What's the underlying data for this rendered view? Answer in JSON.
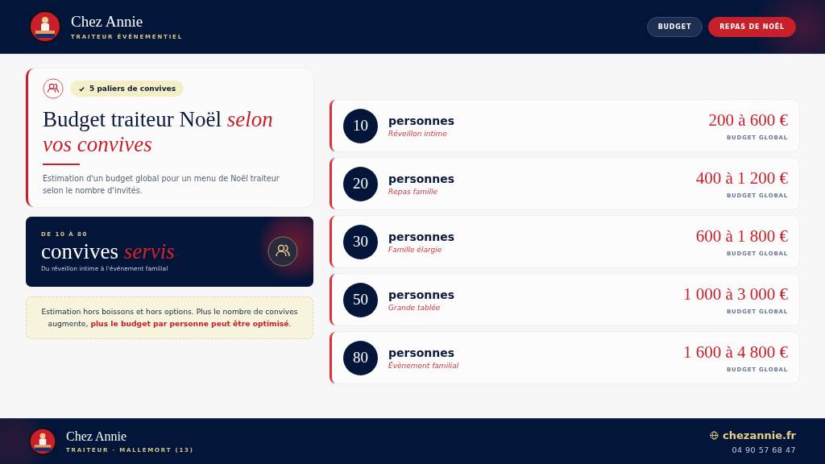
{
  "header": {
    "brand": "Chez Annie",
    "tagline": "TRAITEUR ÉVÉNEMENTIEL",
    "nav": [
      {
        "label": "BUDGET",
        "selected": false
      },
      {
        "label": "REPAS DE NOËL",
        "selected": true
      }
    ]
  },
  "intro": {
    "badge": "5 paliers de convives",
    "title": "Budget traiteur Noël *selon vos convives*",
    "text": "Estimation d'un budget global pour un menu de Noël traiteur selon le nombre d'invités."
  },
  "highlight": {
    "eyebrow": "DE 10 À 80",
    "title": "convives *servis*",
    "subtitle": "Du réveillon intime à l'événement familial"
  },
  "note": "Estimation hors boissons et hors options. Plus le nombre de convives augmente, **plus le budget par personne peut être optimisé**.",
  "tiers": [
    {
      "count": "10",
      "label": "personnes",
      "occasion": "Réveillon intime",
      "price": "200 à 600 €",
      "price_label": "BUDGET GLOBAL"
    },
    {
      "count": "20",
      "label": "personnes",
      "occasion": "Repas famille",
      "price": "400 à 1 200 €",
      "price_label": "BUDGET GLOBAL"
    },
    {
      "count": "30",
      "label": "personnes",
      "occasion": "Famille élargie",
      "price": "600 à 1 800 €",
      "price_label": "BUDGET GLOBAL"
    },
    {
      "count": "50",
      "label": "personnes",
      "occasion": "Grande tablée",
      "price": "1 000 à 3 000 €",
      "price_label": "BUDGET GLOBAL"
    },
    {
      "count": "80",
      "label": "personnes",
      "occasion": "Évènement familial",
      "price": "1 600 à 4 800 €",
      "price_label": "BUDGET GLOBAL"
    }
  ],
  "footer": {
    "brand": "Chez Annie",
    "tagline": "TRAITEUR · MALLEMORT (13)",
    "website": "chezannie.fr",
    "phone": "04 90 57 68 47"
  }
}
